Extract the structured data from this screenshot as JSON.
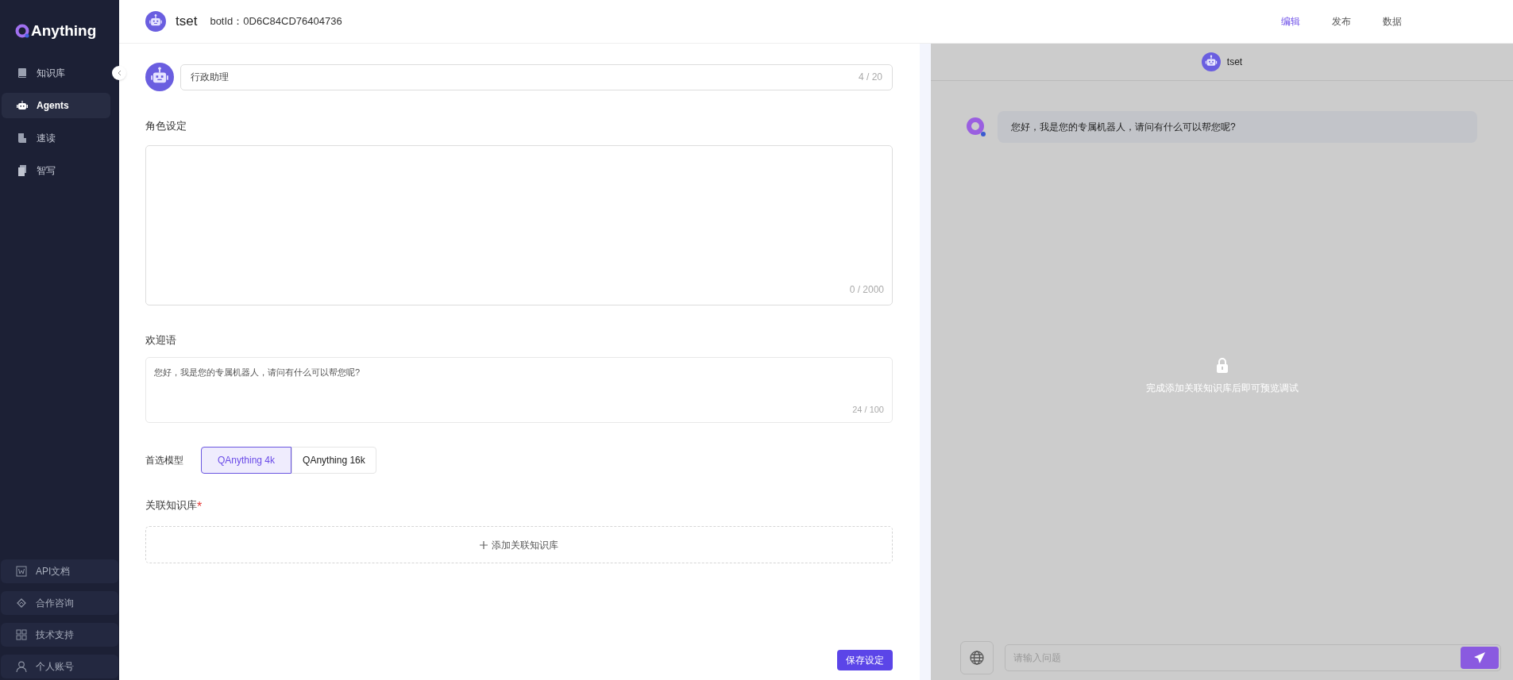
{
  "sidebar": {
    "logo": "Anything",
    "items": [
      {
        "label": "知识库",
        "selected": false
      },
      {
        "label": "Agents",
        "selected": true
      },
      {
        "label": "速读",
        "selected": false
      },
      {
        "label": "智写",
        "selected": false
      }
    ],
    "footer_items": [
      {
        "label": "API文档"
      },
      {
        "label": "合作咨询"
      },
      {
        "label": "技术支持"
      },
      {
        "label": "个人账号"
      }
    ]
  },
  "header": {
    "bot_name": "tset",
    "bot_id": "botId：0D6C84CD76404736",
    "tabs": [
      {
        "label": "编辑",
        "selected": true
      },
      {
        "label": "发布",
        "selected": false
      },
      {
        "label": "数据",
        "selected": false
      }
    ]
  },
  "form": {
    "name": {
      "value": "行政助理",
      "count": "4 / 20"
    },
    "role": {
      "label": "角色设定",
      "count": "0 / 2000"
    },
    "welcome": {
      "label": "欢迎语",
      "value": "您好，我是您的专属机器人，请问有什么可以帮您呢?",
      "count": "24 / 100"
    },
    "model": {
      "label": "首选模型",
      "options": [
        {
          "label": "QAnything 4k",
          "selected": true
        },
        {
          "label": "QAnything 16k",
          "selected": false
        }
      ]
    },
    "knowledge": {
      "label": "关联知识库",
      "required_mark": "*",
      "add_button": "添加关联知识库"
    },
    "save_button": "保存设定"
  },
  "preview": {
    "bot_name": "tset",
    "greeting": "您好，我是您的专属机器人，请问有什么可以帮您呢?",
    "locked_message": "完成添加关联知识库后即可预览调试",
    "input": {
      "placeholder": "请输入问题"
    }
  }
}
